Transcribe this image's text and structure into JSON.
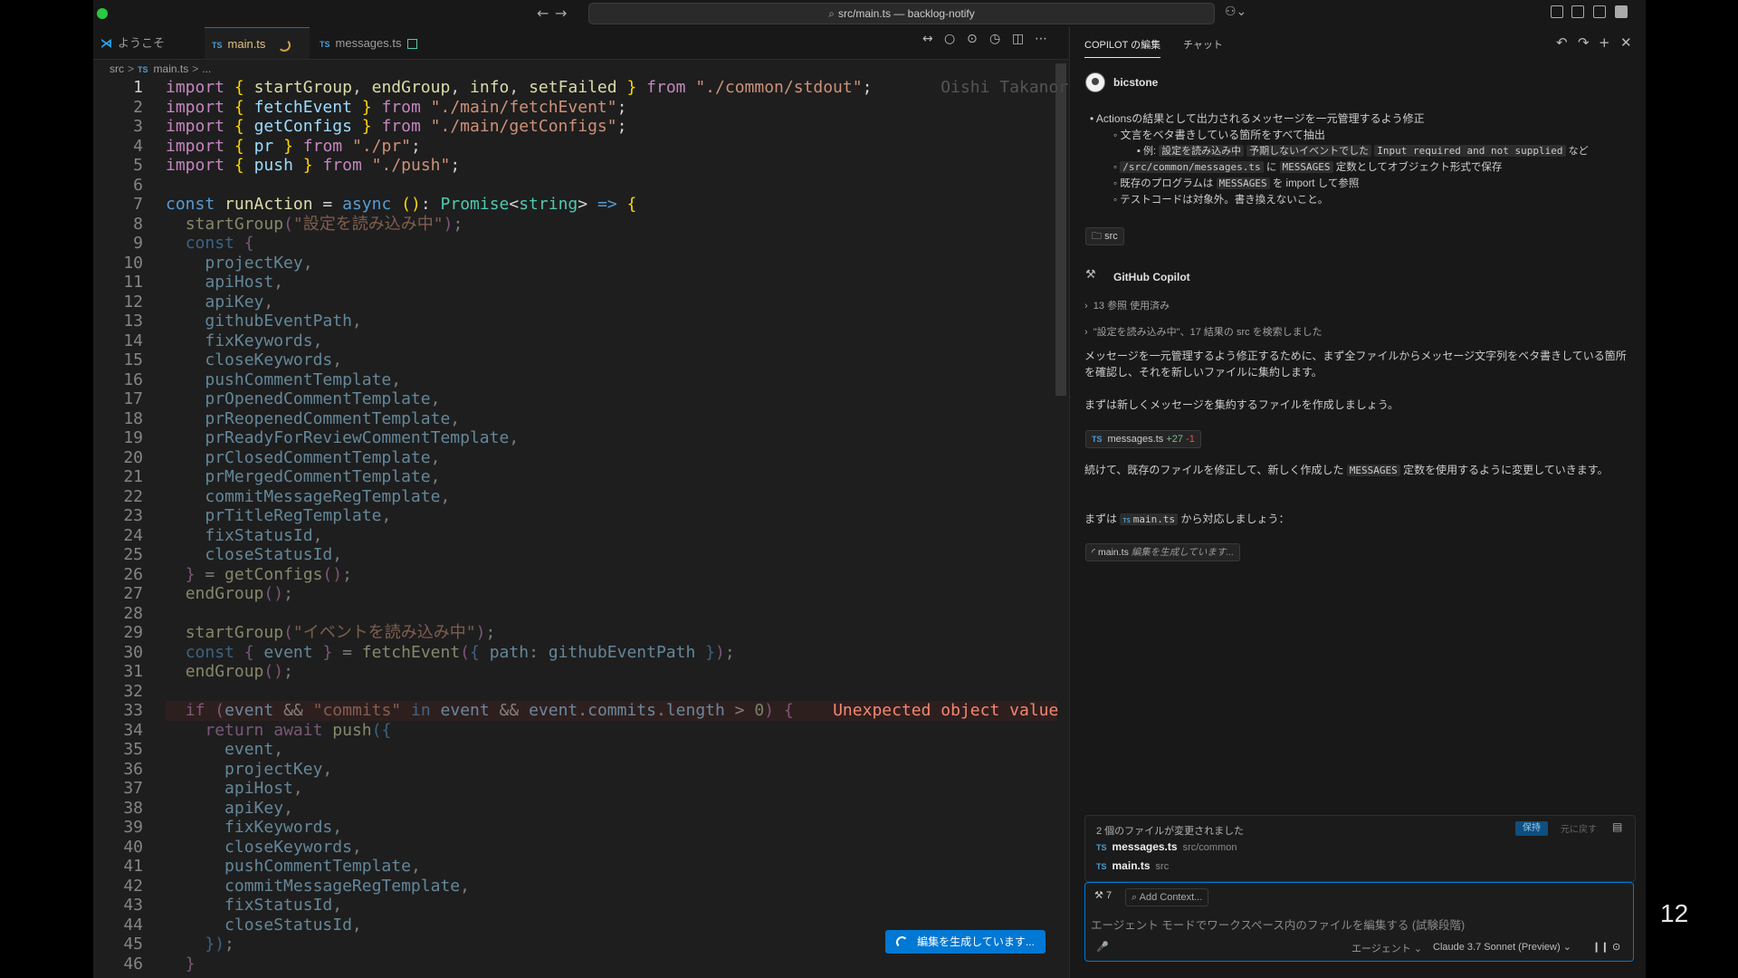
{
  "window": {
    "title": "src/main.ts — backlog-notify",
    "back_arrow": "←",
    "forward_arrow": "→"
  },
  "tabs": [
    {
      "label": "ようこそ"
    },
    {
      "label": "main.ts",
      "badge": "TS"
    },
    {
      "label": "messages.ts",
      "badge": "TS"
    }
  ],
  "breadcrumb": {
    "folder": "src",
    "file": "main.ts",
    "sep": ">",
    "tail": "..."
  },
  "code": {
    "ghost_author": "Oishi Takanori,",
    "lines": [
      "1",
      "2",
      "3",
      "4",
      "5",
      "6",
      "7",
      "8",
      "9",
      "10",
      "11",
      "12",
      "13",
      "14",
      "15",
      "16",
      "17",
      "18",
      "19",
      "20",
      "21",
      "22",
      "23",
      "24",
      "25",
      "26",
      "27",
      "28",
      "29",
      "30",
      "31",
      "32",
      "33",
      "34",
      "35",
      "36",
      "37",
      "38",
      "39",
      "40",
      "41",
      "42",
      "43",
      "44",
      "45",
      "46"
    ],
    "error_message": "Unexpected object value in"
  },
  "generate_button": {
    "label": "編集を生成しています..."
  },
  "panel": {
    "tab_edits": "COPILOT の編集",
    "tab_chat": "チャット",
    "user_name": "bicstone",
    "request": {
      "item1": "Actionsの結果として出力されるメッセージを一元管理するよう修正",
      "item1a": "文言をベタ書きしている箇所をすべて抽出",
      "item1a_example_prefix": "例:",
      "ex1": "設定を読み込み中",
      "ex2": "予期しないイベントでした",
      "ex3": "Input required and not supplied",
      "ex_suffix": "など",
      "item2_path": "/src/common/messages.ts",
      "item2_mid": "に",
      "item2_const": "MESSAGES",
      "item2_tail": "定数としてオブジェクト形式で保存",
      "item3_pre": "既存のプログラムは",
      "item3_const": "MESSAGES",
      "item3_tail": "を import して参照",
      "item4": "テストコードは対象外。書き換えないこと。"
    },
    "src_chip": "src",
    "copilot_name": "GitHub Copilot",
    "refs": "13 参照 使用済み",
    "search": "\"設定を読み込み中\"、17 結果の src を検索しました",
    "para1": "メッセージを一元管理するよう修正するために、まず全ファイルからメッセージ文字列をベタ書きしている箇所を確認し、それを新しいファイルに集約します。",
    "para2": "まずは新しくメッセージを集約するファイルを作成しましょう。",
    "file_chip": {
      "name": "messages.ts",
      "plus": "+27",
      "minus": "-1"
    },
    "para3_pre": "続けて、既存のファイルを修正して、新しく作成した",
    "para3_const": "MESSAGES",
    "para3_tail": "定数を使用するように変更していきます。",
    "para4_pre": "まずは",
    "para4_file": "main.ts",
    "para4_tail": "から対応しましょう：",
    "gen_chip": {
      "file": "main.ts",
      "status": "編集を生成しています..."
    },
    "changed": {
      "header": "2 個のファイルが変更されました",
      "keep": "保持",
      "undo": "元に戻す",
      "files": [
        {
          "name": "messages.ts",
          "path": "src/common"
        },
        {
          "name": "main.ts",
          "path": "src"
        }
      ]
    },
    "input": {
      "tools_count": "7",
      "add_context": "Add Context...",
      "placeholder": "エージェント モードでワークスペース内のファイルを編集する (試験段階)",
      "mode": "エージェント",
      "model": "Claude 3.7 Sonnet (Preview)"
    }
  },
  "slide_page_number": "12"
}
